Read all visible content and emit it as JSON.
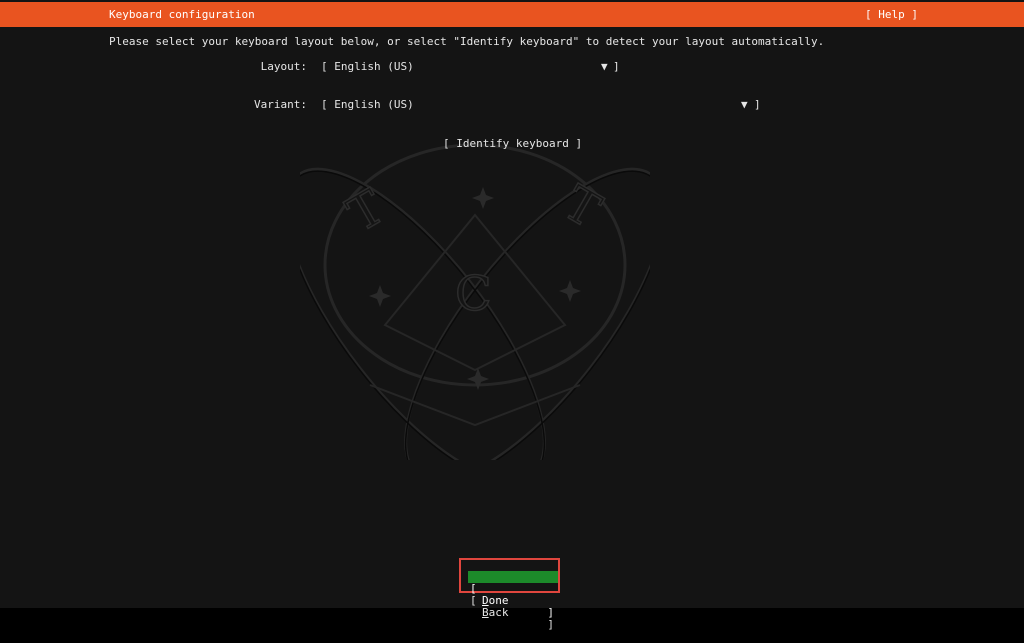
{
  "header": {
    "title": "Keyboard configuration",
    "help_label": "[ Help ]"
  },
  "instruction": "Please select your keyboard layout below, or select \"Identify keyboard\" to detect your layout automatically.",
  "layout": {
    "label": "Layout:",
    "open_bracket": "[",
    "value": "English (US)",
    "arrow": "▼",
    "close_bracket": "]"
  },
  "variant": {
    "label": "Variant:",
    "open_bracket": "[",
    "value": "English (US)",
    "arrow": "▼",
    "close_bracket": "]"
  },
  "identify_label": "[ Identify keyboard ]",
  "buttons": {
    "done": {
      "open": "[",
      "label_first": "D",
      "label_rest": "one",
      "close": "]"
    },
    "back": {
      "open": "[",
      "label_first": "B",
      "label_rest": "ack",
      "close": "]"
    }
  },
  "logo": {
    "letters": [
      "T",
      "T",
      "C"
    ],
    "icon": "atom-logo-watermark"
  },
  "colors": {
    "header_bg": "#e95420",
    "background": "#141414",
    "done_bg": "#1c8a2a",
    "highlight_border": "#e0463e"
  }
}
